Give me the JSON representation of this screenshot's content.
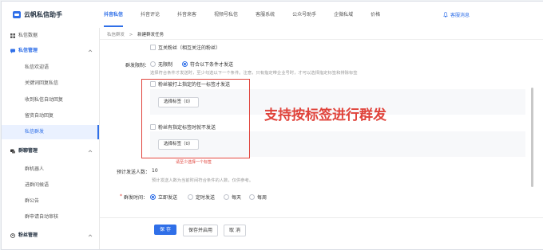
{
  "app": {
    "name": "云帆私信助手"
  },
  "nav": {
    "items": [
      {
        "label": "抖音私信",
        "active": true
      },
      {
        "label": "抖音评论"
      },
      {
        "label": "抖音来客"
      },
      {
        "label": "视频号私信"
      },
      {
        "label": "客服系统"
      },
      {
        "label": "公众号助手"
      },
      {
        "label": "企微私域"
      },
      {
        "label": "价格"
      }
    ],
    "notice": "客服消息"
  },
  "sidebar": {
    "overview": "私信数据",
    "group1": "私信管理",
    "group1_items": [
      "私信欢迎语",
      "关键词回复私信",
      "收到私信自动回复",
      "留资自动回复",
      "私信群发"
    ],
    "group2": "群聊管理",
    "group2_items": [
      "群机器人",
      "进群问候语",
      "群公告",
      "群申请自动审核"
    ],
    "group3": "粉丝管理"
  },
  "breadcrumb": {
    "parent": "私信群发",
    "sep": ">",
    "current": "新建群发任务"
  },
  "form": {
    "mutual_label": "互关粉丝（相互关注的粉丝）",
    "limit_label": "群发限制：",
    "limit_opt1": "无限制",
    "limit_opt2": "符合以下条件才发送",
    "limit_hint": "选择符合条件才发送时，至少勾选以下一个条件。注意，只有指定带企业号时，才可以选择指定标签和排除标签",
    "cond1_label": "粉丝被打上指定的任一标签才发送",
    "cond1_btn": "选择标签（0）",
    "cond2_label": "粉丝有指定标签时就不发送",
    "cond2_btn": "选择标签（0）",
    "error_text": "请至少选择一个标签",
    "est_label": "预计发送人数：",
    "est_value": "10",
    "est_hint": "预计发送人数为当前时间符合条件的人数，仅供参考。",
    "time_label": "群发时间：",
    "time_required": "*",
    "time_opts": [
      "立即发送",
      "定时发送",
      "每天",
      "每周"
    ]
  },
  "annotation": "支持按标签进行群发",
  "footer": {
    "save": "保 存",
    "save_enable": "保存并启用",
    "cancel": "取 消"
  },
  "colors": {
    "primary": "#2f6fe8",
    "danger": "#e0433b"
  }
}
